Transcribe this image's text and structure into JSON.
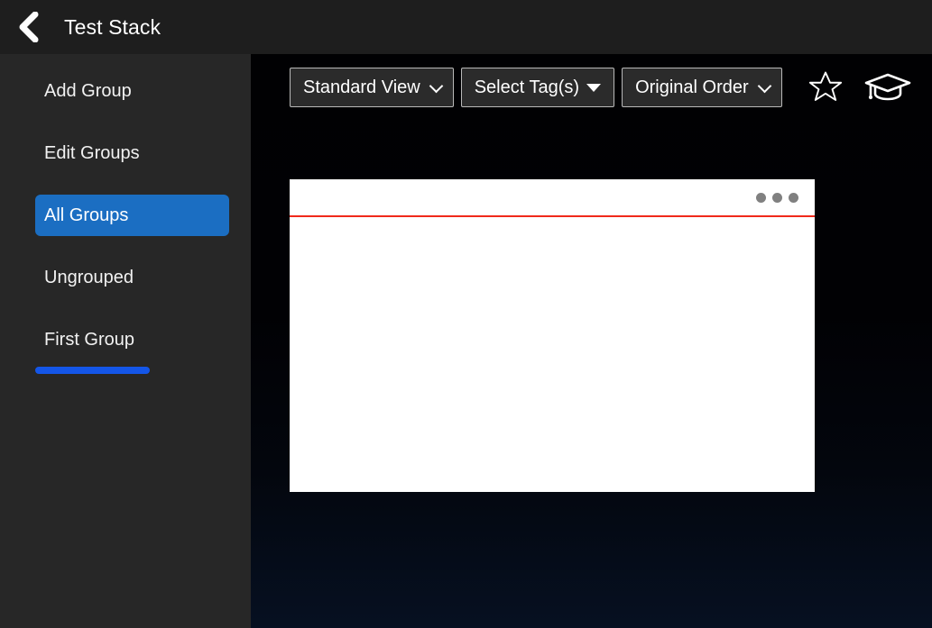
{
  "header": {
    "title": "Test Stack",
    "back_icon": "chevron-left-icon"
  },
  "sidebar": {
    "items": [
      {
        "label": "Add Group",
        "active": false
      },
      {
        "label": "Edit Groups",
        "active": false
      },
      {
        "label": "All Groups",
        "active": true
      },
      {
        "label": "Ungrouped",
        "active": false
      },
      {
        "label": "First Group",
        "active": false
      }
    ],
    "progress_bar": {
      "name": "first-group-progress-bar",
      "color": "#1456e8"
    },
    "active_color": "#1b6ec2",
    "background": "#272727"
  },
  "toolbar": {
    "view_select": {
      "value": "Standard View",
      "icon": "chevron-down-icon"
    },
    "tag_dropdown": {
      "value": "Select Tag(s)",
      "icon": "caret-down-icon"
    },
    "order_select": {
      "value": "Original Order",
      "icon": "chevron-down-icon"
    },
    "favorite_icon": "star-outline-icon",
    "study_icon": "graduation-cap-icon"
  },
  "card": {
    "menu_icon": "kebab-menu-icon",
    "divider_color": "#f0291b",
    "background": "#ffffff",
    "body_text": ""
  }
}
